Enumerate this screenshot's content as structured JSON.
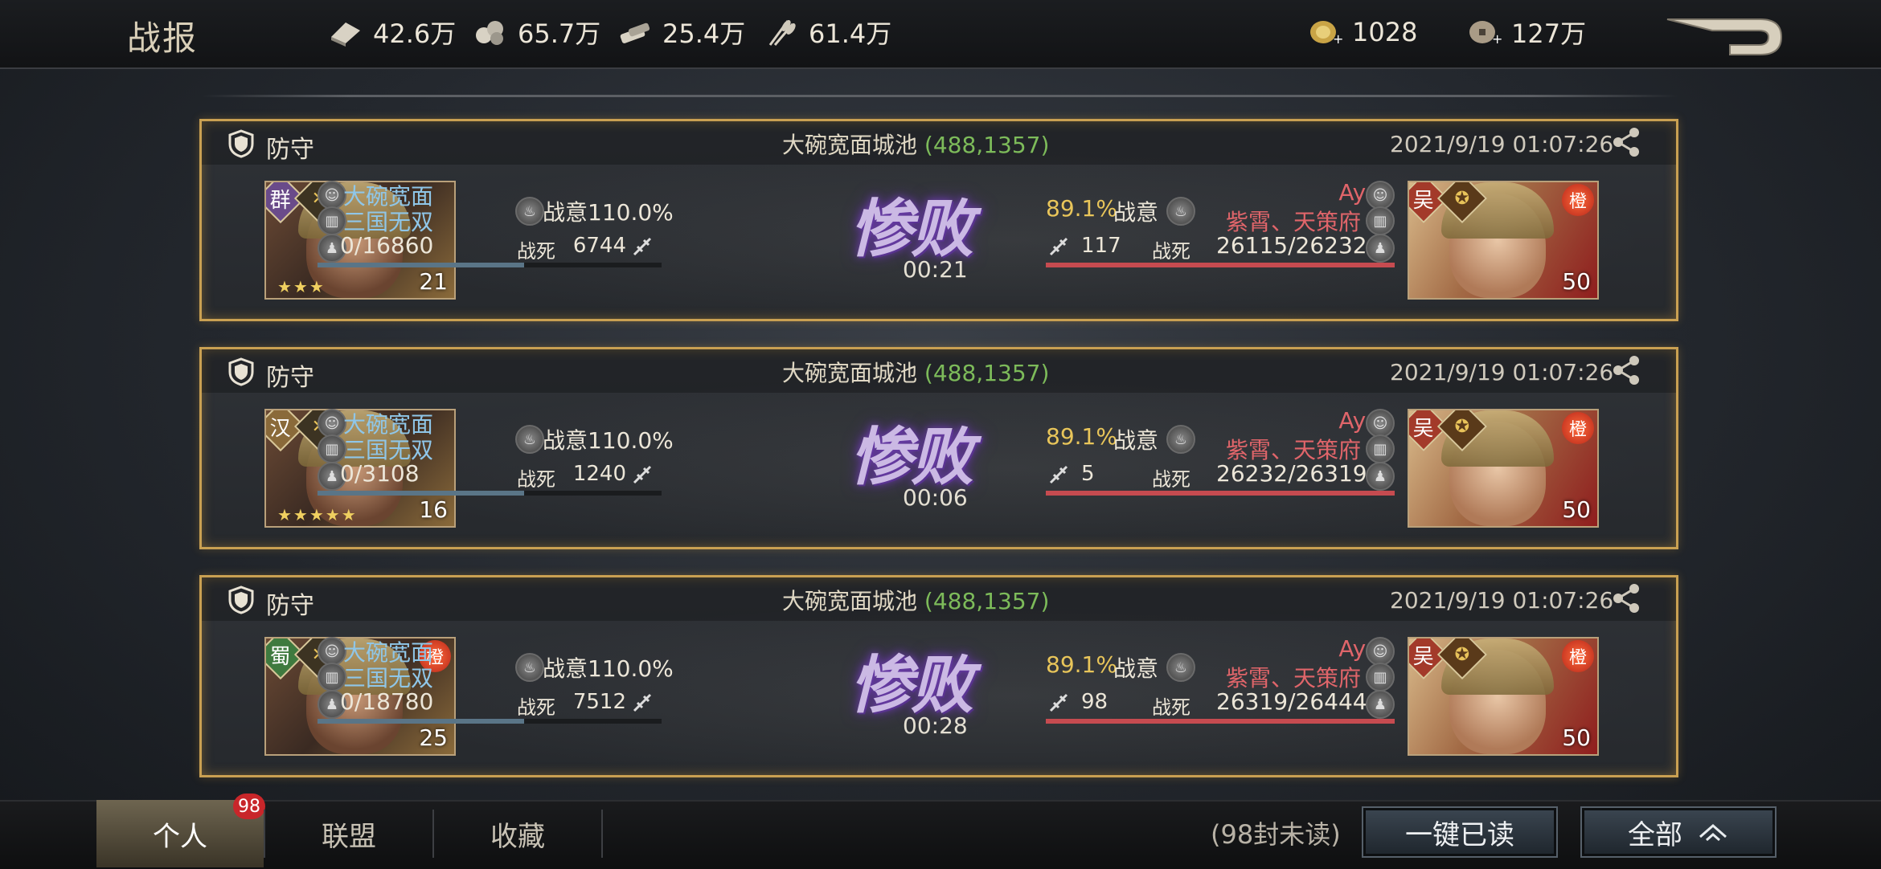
{
  "header": {
    "title": "战报",
    "resources": [
      {
        "icon": "wood-icon",
        "value": "42.6万"
      },
      {
        "icon": "stone-icon",
        "value": "65.7万"
      },
      {
        "icon": "iron-icon",
        "value": "25.4万"
      },
      {
        "icon": "grain-icon",
        "value": "61.4万"
      }
    ],
    "jade": "1028",
    "copper": "127万"
  },
  "reports": [
    {
      "type": "防守",
      "location": "大碗宽面城池",
      "coord": "(488,1357)",
      "time": "2021/9/19 01:07:26",
      "left": {
        "faction": "群",
        "level": "21",
        "stars": "★★★",
        "player": "大碗宽面",
        "alliance": "三国无双",
        "troops": "0/16860",
        "morale_label": "战意110.0%",
        "dead_label": "战死",
        "dead": "6744",
        "bar": 0.6
      },
      "result": "惨败",
      "duration": "00:21",
      "right": {
        "faction": "吴",
        "level": "50",
        "elite": "橙",
        "player": "Ayu",
        "alliance": "紫霄、天策府",
        "troops": "26115/26232",
        "morale_pct": "89.1%",
        "morale_label": "战意",
        "dead_label": "战死",
        "dead": "117",
        "bar": 1.0
      }
    },
    {
      "type": "防守",
      "location": "大碗宽面城池",
      "coord": "(488,1357)",
      "time": "2021/9/19 01:07:26",
      "left": {
        "faction": "汉",
        "level": "16",
        "stars": "★★★★★",
        "player": "大碗宽面",
        "alliance": "三国无双",
        "troops": "0/3108",
        "morale_label": "战意110.0%",
        "dead_label": "战死",
        "dead": "1240",
        "bar": 0.6
      },
      "result": "惨败",
      "duration": "00:06",
      "right": {
        "faction": "吴",
        "level": "50",
        "elite": "橙",
        "player": "Ayu",
        "alliance": "紫霄、天策府",
        "troops": "26232/26319",
        "morale_pct": "89.1%",
        "morale_label": "战意",
        "dead_label": "战死",
        "dead": "5",
        "bar": 1.0
      }
    },
    {
      "type": "防守",
      "location": "大碗宽面城池",
      "coord": "(488,1357)",
      "time": "2021/9/19 01:07:26",
      "left": {
        "faction": "蜀",
        "level": "25",
        "stars": "",
        "elite": "橙",
        "player": "大碗宽面",
        "alliance": "三国无双",
        "troops": "0/18780",
        "morale_label": "战意110.0%",
        "dead_label": "战死",
        "dead": "7512",
        "bar": 0.6
      },
      "result": "惨败",
      "duration": "00:28",
      "right": {
        "faction": "吴",
        "level": "50",
        "elite": "橙",
        "player": "Ayu",
        "alliance": "紫霄、天策府",
        "troops": "26319/26444",
        "morale_pct": "89.1%",
        "morale_label": "战意",
        "dead_label": "战死",
        "dead": "98",
        "bar": 1.0
      }
    }
  ],
  "footer": {
    "tabs": [
      "个人",
      "联盟",
      "收藏"
    ],
    "badge": "98",
    "unread": "(98封未读)",
    "read_all": "一键已读",
    "filter": "全部"
  },
  "colors": {
    "gold_border": "#c9a052",
    "faction_qun": "#6a4b8a",
    "faction_han": "#8a6a3a",
    "faction_shu": "#3f7a3f",
    "faction_wu": "#a33a2a"
  }
}
